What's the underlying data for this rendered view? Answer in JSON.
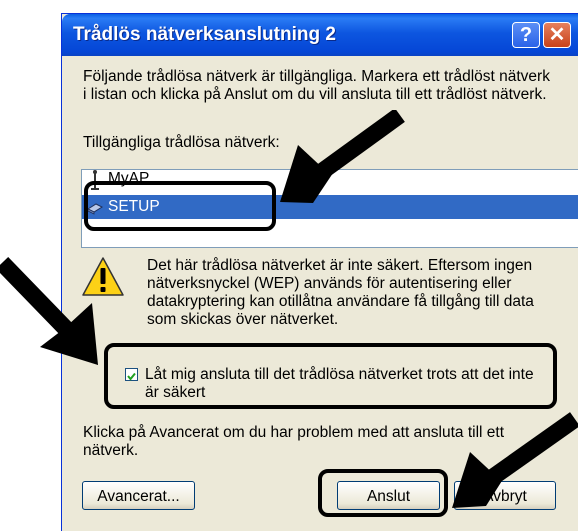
{
  "window": {
    "title": "Trådlös nätverksanslutning 2",
    "help_glyph": "?",
    "close_glyph": "✕"
  },
  "intro": {
    "line1": "Följande trådlösa nätverk är tillgängliga. Markera ett trådlöst nätverk",
    "line2": "i listan och klicka på Anslut om du vill ansluta till ett trådlöst nätverk."
  },
  "networks": {
    "label": "Tillgängliga trådlösa nätverk:",
    "items": [
      {
        "name": "MyAP",
        "icon": "antenna-icon",
        "selected": false
      },
      {
        "name": "SETUP",
        "icon": "computer-icon",
        "selected": true
      }
    ]
  },
  "warning": {
    "icon": "warning-icon",
    "line1": "Det här trådlösa nätverket är inte säkert. Eftersom ingen",
    "line2": "nätverksnyckel (WEP) används för autentisering eller",
    "line3": "datakryptering kan otillåtna användare få tillgång till data",
    "line4": "som skickas över nätverket."
  },
  "confirm": {
    "checked": true,
    "line1": "Låt mig ansluta till det trådlösa nätverket trots att det inte",
    "line2": "är säkert"
  },
  "advanced_hint": {
    "line1": "Klicka på Avancerat om du har problem med att ansluta till ett",
    "line2": "nätverk."
  },
  "buttons": {
    "advanced": "Avancerat...",
    "connect": "Anslut",
    "cancel": "Avbryt"
  },
  "colors": {
    "titlebar": "#0a5fe4",
    "window_bg": "#ece9d8",
    "selection": "#316ac5",
    "annotation": "#000000"
  }
}
